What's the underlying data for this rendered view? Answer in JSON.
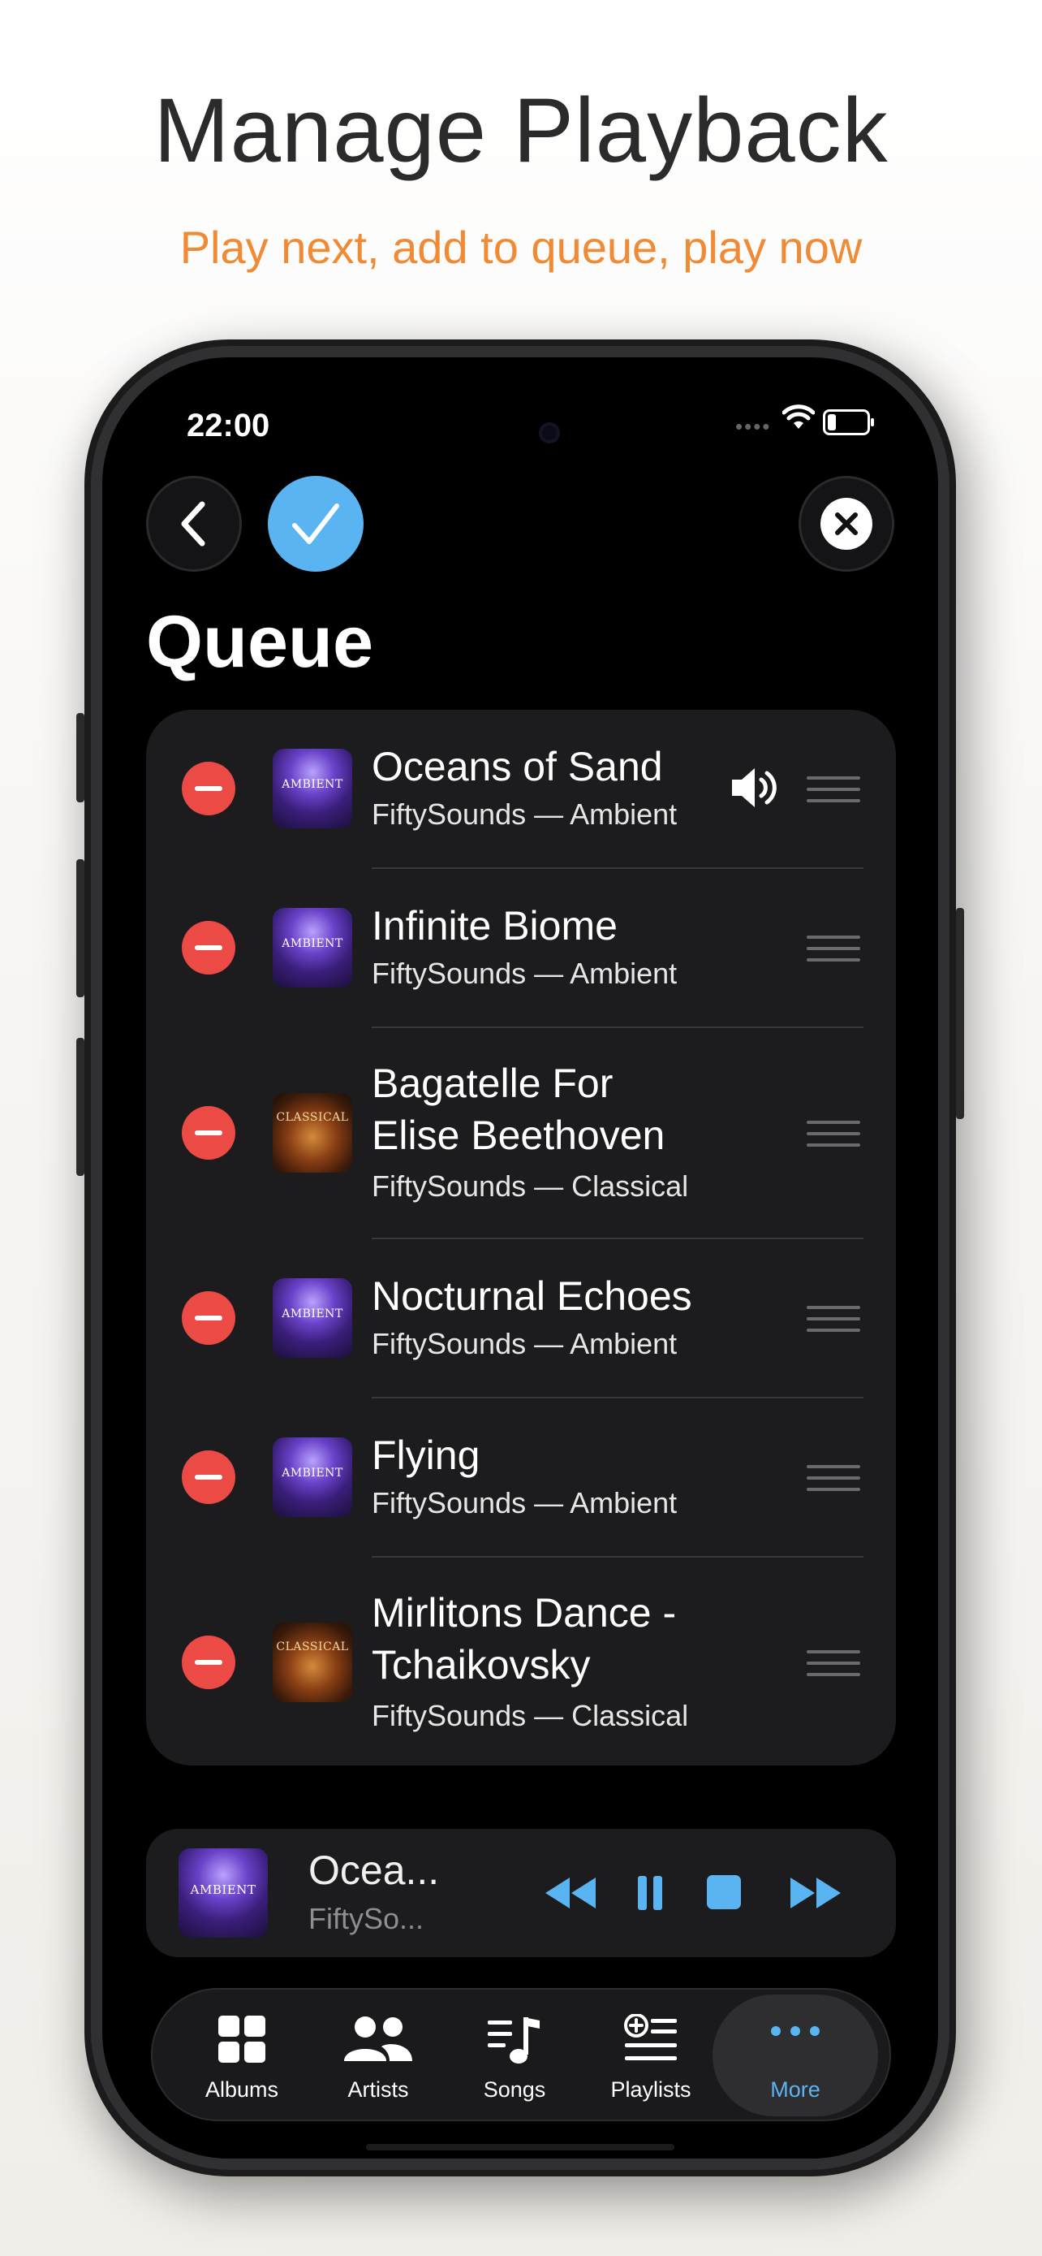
{
  "promo": {
    "title": "Manage Playback",
    "subtitle": "Play next, add to queue, play now"
  },
  "status_bar": {
    "time": "22:00",
    "battery_level": 0.2
  },
  "toolbar": {
    "back_icon": "chevron-left-icon",
    "done_icon": "checkmark-icon",
    "close_icon": "xmark-circle-icon"
  },
  "queue": {
    "title": "Queue",
    "items": [
      {
        "title_lines": [
          "Oceans of Sand"
        ],
        "subtitle": "FiftySounds — Ambient",
        "artwork": "AMBIENT",
        "playing": true
      },
      {
        "title_lines": [
          "Infinite Biome"
        ],
        "subtitle": "FiftySounds — Ambient",
        "artwork": "AMBIENT",
        "playing": false
      },
      {
        "title_lines": [
          "Bagatelle For",
          "Elise Beethoven"
        ],
        "subtitle": "FiftySounds — Classical",
        "artwork": "CLASSICAL",
        "playing": false
      },
      {
        "title_lines": [
          "Nocturnal Echoes"
        ],
        "subtitle": "FiftySounds — Ambient",
        "artwork": "AMBIENT",
        "playing": false
      },
      {
        "title_lines": [
          "Flying"
        ],
        "subtitle": "FiftySounds — Ambient",
        "artwork": "AMBIENT",
        "playing": false
      },
      {
        "title_lines": [
          "Mirlitons Dance -",
          "Tchaikovsky"
        ],
        "subtitle": "FiftySounds — Classical",
        "artwork": "CLASSICAL",
        "playing": false
      }
    ]
  },
  "mini_player": {
    "title": "Ocea...",
    "subtitle": "FiftySo...",
    "artwork": "AMBIENT",
    "controls": [
      "rewind-icon",
      "pause-icon",
      "stop-icon",
      "fast-forward-icon"
    ]
  },
  "tabs": [
    {
      "label": "Albums",
      "icon": "albums-grid-icon",
      "active": false
    },
    {
      "label": "Artists",
      "icon": "people-icon",
      "active": false
    },
    {
      "label": "Songs",
      "icon": "music-note-list-icon",
      "active": false
    },
    {
      "label": "Playlists",
      "icon": "playlist-add-icon",
      "active": false
    },
    {
      "label": "More",
      "icon": "ellipsis-icon",
      "active": true
    }
  ],
  "colors": {
    "accent": "#5ab4f2",
    "promo_subtitle": "#f08a34",
    "remove": "#eb4a45"
  }
}
